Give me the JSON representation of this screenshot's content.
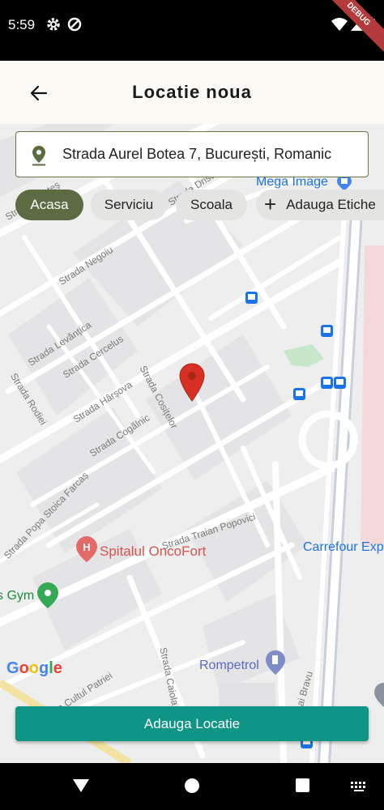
{
  "status_bar": {
    "time": "5:59",
    "debug_label": "DEBUG"
  },
  "app_bar": {
    "title": "Locatie noua"
  },
  "search": {
    "value": "Strada Aurel Botea 7, București, Romanic"
  },
  "chips": [
    {
      "label": "Acasa",
      "active": true
    },
    {
      "label": "Serviciu",
      "active": false
    },
    {
      "label": "Scoala",
      "active": false
    },
    {
      "label": "Adauga Etiche",
      "active": false
    }
  ],
  "map": {
    "street_labels": [
      "Strada Negoiu",
      "Strada Levănțica",
      "Strada Cercelus",
      "Strada Rodiei",
      "Strada Hârșova",
      "Strada Cosițelor",
      "Strada Cogălnic",
      "Strada Popa Stoica Farcaș",
      "Strada Traian Popovici",
      "Strada Cultul Patriei",
      "Strada Caiola",
      "Mihai Bravu",
      "Strada Dristor",
      "Strada Mesteș"
    ],
    "poi": {
      "mega_image": "Mega Image",
      "carrefour": "Carrefour Exp",
      "oncofort": "Spitalul OncoFort",
      "gym": "s Gym",
      "rompetrol": "Rompetrol"
    },
    "google": [
      "G",
      "o",
      "o",
      "g",
      "l",
      "e"
    ],
    "colors": {
      "accent": "#5d6b43",
      "button": "#0e9585",
      "marker": "#d93025",
      "poi_blue": "#1a73e8"
    }
  },
  "footer": {
    "add_button": "Adauga Locatie"
  }
}
